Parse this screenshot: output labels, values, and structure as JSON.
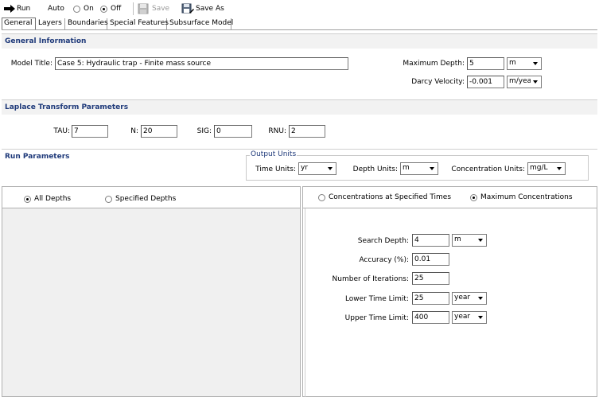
{
  "toolbar": {
    "run_label": "Run",
    "auto_label": "Auto",
    "on_label": "On",
    "off_label": "Off",
    "save_label": "Save",
    "save_as_label": "Save As",
    "auto_mode": "Off"
  },
  "tabs": [
    {
      "label": "General",
      "active": true
    },
    {
      "label": "Layers",
      "active": false
    },
    {
      "label": "Boundaries",
      "active": false
    },
    {
      "label": "Special Features",
      "active": false
    },
    {
      "label": "Subsurface Model",
      "active": false
    }
  ],
  "general": {
    "heading": "General Information",
    "model_title_label": "Model Title:",
    "model_title": "Case 5: Hydraulic trap - Finite mass source",
    "max_depth_label": "Maximum Depth:",
    "max_depth": "5",
    "max_depth_unit": "m",
    "darcy_label": "Darcy Velocity:",
    "darcy": "-0.001",
    "darcy_unit": "m/year"
  },
  "laplace": {
    "heading": "Laplace Transform Parameters",
    "tau_label": "TAU:",
    "tau": "7",
    "n_label": "N:",
    "n": "20",
    "sig_label": "SIG:",
    "sig": "0",
    "rnu_label": "RNU:",
    "rnu": "2"
  },
  "run": {
    "heading": "Run Parameters",
    "output_units_label": "Output Units",
    "time_units_label": "Time Units:",
    "time_units": "yr",
    "depth_units_label": "Depth Units:",
    "depth_units": "m",
    "conc_units_label": "Concentration Units:",
    "conc_units": "mg/L"
  },
  "left_panel": {
    "all_depths_label": "All Depths",
    "specified_depths_label": "Specified Depths",
    "selected": "All Depths"
  },
  "right_panel": {
    "conc_times_label": "Concentrations at Specified Times",
    "max_conc_label": "Maximum Concentrations",
    "selected": "Maximum Concentrations",
    "search_depth_label": "Search Depth:",
    "search_depth": "4",
    "search_depth_unit": "m",
    "accuracy_label": "Accuracy (%):",
    "accuracy": "0.01",
    "iterations_label": "Number of Iterations:",
    "iterations": "25",
    "lower_time_label": "Lower Time Limit:",
    "lower_time": "25",
    "lower_time_unit": "year",
    "upper_time_label": "Upper Time Limit:",
    "upper_time": "400",
    "upper_time_unit": "year"
  }
}
